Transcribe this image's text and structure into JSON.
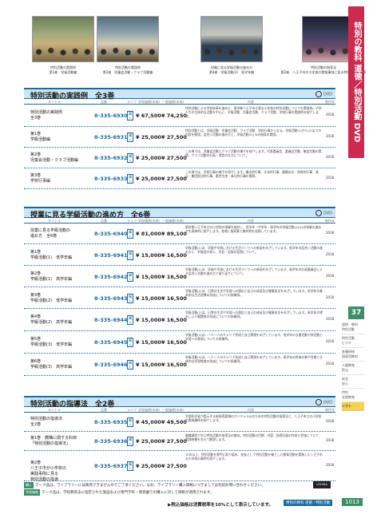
{
  "photos": [
    {
      "caption": "特別活動の実践例\n第1巻　学級活動編"
    },
    {
      "caption": "特別活動の実践例\n第2巻　児童会活動・クラブ活動編"
    },
    {
      "caption": "授業に見る学級活動の進め方\n第4巻　学級活動(2)　低学年編"
    },
    {
      "caption": "特別活動の指導法\n第2巻　八王子市が小学校の実践事例に見る特別活動の指導"
    }
  ],
  "sidebar": {
    "title": "特別の教科 道徳／特別活動 DVD",
    "page_number": "37",
    "items": [
      "道徳・教科\n特別活動",
      "特別活動\nビデオ",
      "各種研修\n指導用教材",
      "人権教育\n防災",
      "安全\n安心",
      "特別\n支援教育",
      "ソフト"
    ],
    "page_label": "1013"
  },
  "sections": [
    {
      "title": "特別活動の実践例　全3巻",
      "dvd": "DVD",
      "columns": {
        "name": "タイトル",
        "code": "品番",
        "opt": "ライブ",
        "p1": "学校価格(本体)",
        "p2": "一般価格(本体)",
        "desc": "内容",
        "year": "制作年"
      },
      "rows": [
        {
          "name": "特別活動の実践例\n全3巻",
          "code": "8-335-6930",
          "opt": "購入",
          "p1": "¥ 67,500",
          "p2": "¥ 74,250",
          "desc": "特別活動による学校改革を進めた、東京都八王子市立第五小学校の特別活動についての実践例。子供たちの主体的な活動を中心に、学級活動、児童会活動、クラブ活動、学校行事の実践例を紹介します。",
          "year": "2018"
        },
        {
          "name": "第1巻\n学級活動編",
          "code": "8-335-6931",
          "opt": "購入",
          "p1": "¥ 25,000",
          "p2": "¥ 27,500",
          "desc": "特別活動とは、学級活動、児童会活動、クラブ活動、学校行事からなる。学級活動(1)から(3)までの内容を解説。話合い活動の進め方と、学級活動(2)(3)の指導の実際。",
          "year": "2018"
        },
        {
          "name": "第2巻\n児童会活動・クラブ活動編",
          "code": "8-335-6932",
          "opt": "購入",
          "p1": "¥ 25,000",
          "p2": "¥ 27,500",
          "desc": "この巻では、児童会活動とクラブ活動の様子を紹介します。代表委員会、委員会活動、集会活動の実際。クラブ活動の計画・運営の仕方について。",
          "year": "2018"
        },
        {
          "name": "第3巻\n学校行事編",
          "code": "8-335-6933",
          "opt": "購入",
          "p1": "¥ 25,000",
          "p2": "¥ 27,500",
          "desc": "この巻では、学校行事の様子を紹介します。儀式的行事、文化的行事、健康安全・体育的行事、遠足・集団宿泊的行事、勤労生産・奉仕的行事の実際。",
          "year": "2018"
        }
      ]
    },
    {
      "title": "授業に見る学級活動の進め方　全6巻",
      "dvd": "DVD",
      "columns": {
        "name": "タイトル",
        "code": "品番",
        "opt": "ライブ",
        "p1": "学校価格(本体)",
        "p2": "一般価格(本体)",
        "desc": "内容",
        "year": "制作年"
      },
      "rows": [
        {
          "name": "授業に見る学級活動の\n進め方　全6巻",
          "code": "8-335-6940",
          "opt": "購入",
          "p1": "¥ 81,000",
          "p2": "¥ 89,100",
          "desc": "東京都八王子市立の小学校の授業を取材し、低学年・中学年・高学年の学級活動(1)(2)の授業の進め方を具体的に紹介します。各巻に指導案と教材例を収録しています。",
          "year": "2018"
        },
        {
          "name": "第1巻\n学級活動(1)　低学年編",
          "code": "8-335-6941",
          "opt": "購入",
          "p1": "¥ 15,000",
          "p2": "¥ 16,500",
          "desc": "学級活動(1)は、学級や学校における生活づくりへの参画をめざしています。低学年の話合い活動の進め方と、学級会の導入、司会・記録の役割について。",
          "year": "2018"
        },
        {
          "name": "第2巻\n学級活動(1)　高学年編",
          "code": "8-335-6942",
          "opt": "購入",
          "p1": "¥ 15,000",
          "p2": "¥ 16,500",
          "desc": "学級活動(1)は、学級や学校における生活づくりへの参画をめざしています。高学年の計画委員会による話合い活動の進め方と振り返りについて。",
          "year": "2018"
        },
        {
          "name": "第3巻\n学級活動(2)　低学年編",
          "code": "8-335-6943",
          "opt": "購入",
          "p1": "¥ 15,000",
          "p2": "¥ 16,500",
          "desc": "学級活動(2)は、日常の生活や学習への適応と自己の成長及び健康安全をめざしています。低学年の基本的な生活習慣の形成についての授業例。",
          "year": "2018"
        },
        {
          "name": "第4巻\n学級活動(2)　高学年編",
          "code": "8-335-6944",
          "opt": "購入",
          "p1": "¥ 15,000",
          "p2": "¥ 16,500",
          "desc": "学級活動(2)は、日常の生活や学習への適応と自己の成長及び健康安全をめざしています。高学年の望ましい人間関係の形成についての授業例。",
          "year": "2018"
        },
        {
          "name": "第5巻\n学級活動(3)　低学年編",
          "code": "8-335-6945",
          "opt": "購入",
          "p1": "¥ 15,000",
          "p2": "¥ 16,500",
          "desc": "学級活動(3)は、一人一人のキャリア形成と自己実現をめざしています。低学年の当番活動や係活動と学習への意欲についての授業例。",
          "year": "2018"
        },
        {
          "name": "第6巻\n学級活動(3)　高学年編",
          "code": "8-335-6946",
          "opt": "購入",
          "p1": "¥ 15,000",
          "p2": "¥ 16,500",
          "desc": "学級活動(3)は、一人一人のキャリア形成と自己実現をめざしています。高学年の将来の夢や目標と主体的な学習態度の形成についての授業例。",
          "year": "2018"
        }
      ]
    },
    {
      "title": "特別活動の指導法　全2巻",
      "dvd": "DVD",
      "columns": {
        "name": "タイトル",
        "code": "品番",
        "opt": "ライブ",
        "p1": "学校価格(本体)",
        "p2": "一般価格(本体)",
        "desc": "内容",
        "year": "制作年"
      },
      "rows": [
        {
          "name": "特別活動の指導法\n全2巻",
          "code": "8-335-6935",
          "opt": "購入",
          "p1": "¥ 45,000",
          "p2": "¥ 49,500",
          "desc": "文部科学省が提示する新指導要領のカリキュラムのための特別活動の指導法と、八王子市立の小学校の実践事例を紹介します。",
          "year": "2018"
        },
        {
          "name": "第1巻　教職に関する科目\n「特別活動の指導法」",
          "code": "8-335-6936",
          "opt": "購入",
          "p1": "¥ 25,000",
          "p2": "¥ 27,500",
          "desc": "教職課程で学ぶ特別活動の指導法の基本。特別活動の目標、内容、指導計画の作成と評価について、実践映像を交えて解説します。",
          "year": "2018"
        },
        {
          "name": "第2巻\n八王子市が小学校の\n実践事例に見る\n特別活動の指導",
          "code": "8-335-6937",
          "opt": "購入",
          "p1": "¥ 25,000",
          "p2": "¥ 27,500",
          "desc": "30年以上、特別活動を専門に取り組み、校長として特別活動を軸とした教育活動を実践した八王子市の小学校の事例を紹介します。",
          "year": "2018"
        }
      ]
    }
  ],
  "notes": {
    "line1_tag": "購入",
    "line1": "マーク品は、ライブラリーには販売できませんのでご了承ください。なお、ライブラリー購入価格につきましては別途お問い合わせください。",
    "line2_tag": "学校価格",
    "line2": "マーク品は、学校教育法に指定された施設および専門学校・保育園での購入に対して価格が適用されます。",
    "tax": "▶税込価格は消費税率を10%として表示しています。",
    "footer_label": "特別の教科 道徳／特別活動",
    "brand": "UCHIDA"
  }
}
